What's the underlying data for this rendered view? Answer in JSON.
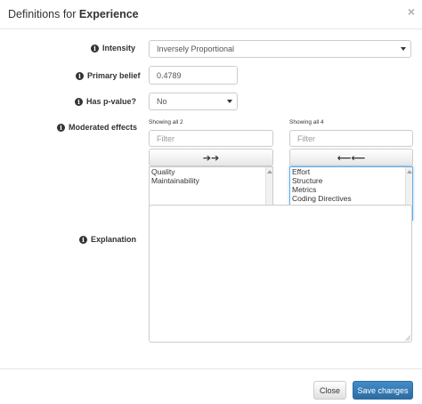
{
  "modal": {
    "title_prefix": "Definitions for ",
    "title_subject": "Experience",
    "close_symbol": "×"
  },
  "form": {
    "intensity": {
      "label": "Intensity",
      "value": "Inversely Proportional"
    },
    "primary_belief": {
      "label": "Primary belief",
      "value": "0.4789"
    },
    "has_pvalue": {
      "label": "Has p-value?",
      "value": "No"
    },
    "moderated_effects": {
      "label": "Moderated effects",
      "selected": {
        "status": "Showing all 2",
        "filter_placeholder": "Filter",
        "move_symbol": "➔➔",
        "items": [
          "Quality",
          "Maintainability"
        ]
      },
      "available": {
        "status": "Showing all 4",
        "filter_placeholder": "Filter",
        "move_symbol": "⟵⟵",
        "items": [
          "Effort",
          "Structure",
          "Metrics",
          "Coding Directives"
        ]
      }
    },
    "explanation": {
      "label": "Explanation",
      "value": ""
    }
  },
  "footer": {
    "close_label": "Close",
    "save_label": "Save changes"
  },
  "icons": {
    "info": "i"
  },
  "colors": {
    "primary": "#428bca",
    "focus": "#66afe9"
  }
}
